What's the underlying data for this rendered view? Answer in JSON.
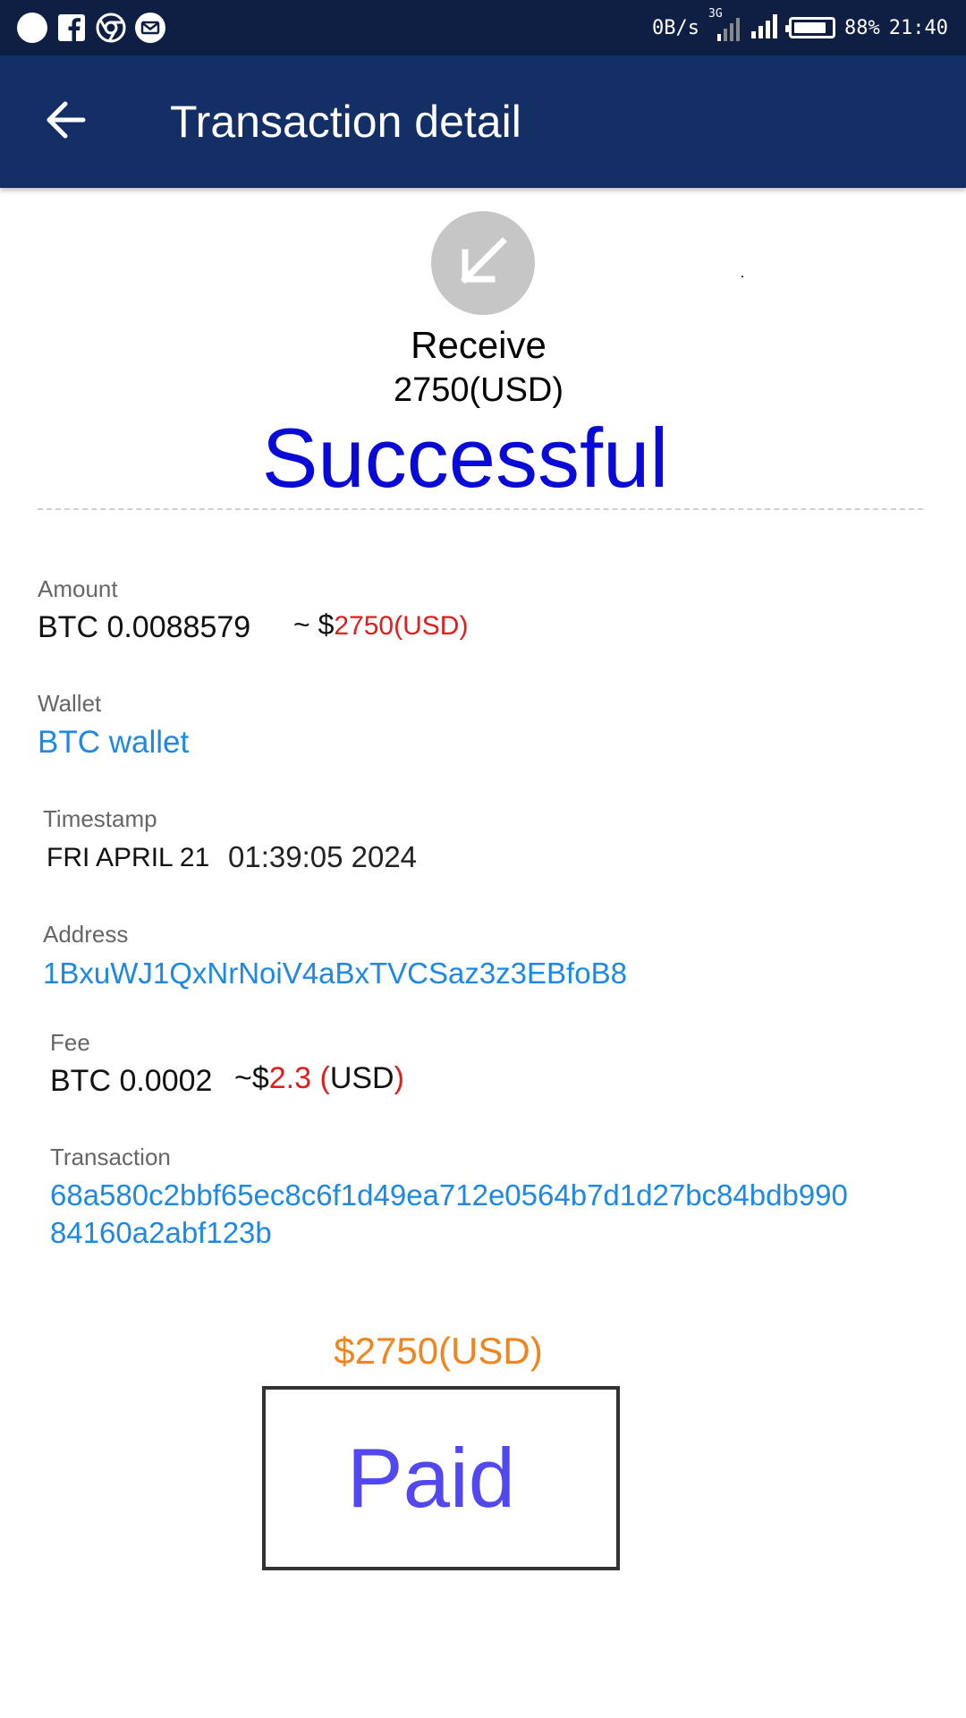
{
  "status_bar": {
    "left_icons": [
      "notification-dot-icon",
      "facebook-icon",
      "chrome-icon",
      "mail-icon"
    ],
    "net_speed": "0B/s",
    "network_type": "3G",
    "battery": "88%",
    "battery_level": 0.88,
    "time": "21:40"
  },
  "app_bar": {
    "title": "Transaction detail",
    "back_icon": "arrow-left-icon",
    "background": "#142f66"
  },
  "summary": {
    "icon": "arrow-down-left-icon",
    "type": "Receive",
    "amount": "2750(USD)",
    "status": "Successful"
  },
  "fields": {
    "amount": {
      "label": "Amount",
      "btc": "BTC 0.0088579",
      "approx_prefix": "~ $",
      "usd": "2750(USD)"
    },
    "wallet": {
      "label": "Wallet",
      "value": "BTC wallet"
    },
    "timestamp": {
      "label": "Timestamp",
      "date": "FRI APRIL 21",
      "time": "01:39:05 2024"
    },
    "address": {
      "label": "Address",
      "value": "1BxuWJ1QxNrNoiV4aBxTVCSaz3z3EBfoB8"
    },
    "fee": {
      "label": "Fee",
      "btc": "BTC 0.0002",
      "approx_prefix": "~$",
      "usd_value": "2.3",
      "open_paren": "(",
      "unit": "USD",
      "close_paren": ")"
    },
    "transaction": {
      "label": "Transaction",
      "line1": "68a580c2bbf65ec8c6f1d49ea712e0564b7d1d27bc84bdb990",
      "line2": "84160a2abf123b"
    }
  },
  "payment": {
    "amount": "$2750(USD)",
    "stamp": "Paid"
  },
  "colors": {
    "link": "#1e88e5",
    "status": "#0a0ad6",
    "usd_red": "#e31c1c",
    "payment_orange": "#f0851f",
    "stamp_purple": "#5348f0"
  }
}
